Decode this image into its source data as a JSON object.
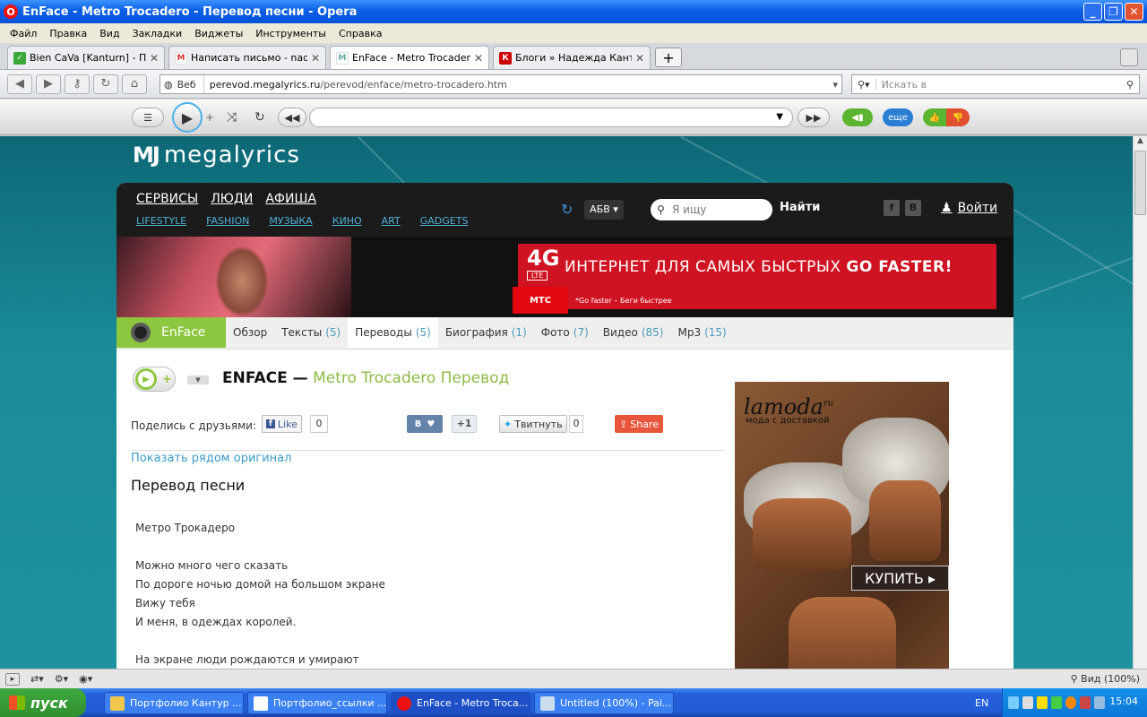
{
  "window": {
    "title": "EnFace - Metro Trocadero - Перевод песни - Opera",
    "minimize": "_",
    "maximize": "❐",
    "close": "✕"
  },
  "menu": [
    "Файл",
    "Правка",
    "Вид",
    "Закладки",
    "Виджеты",
    "Инструменты",
    "Справка"
  ],
  "tabs": [
    {
      "label": "Bien CaVa [Kanturn] - П...",
      "close": "✕",
      "icon_color": "#3aa93a",
      "icon_char": "✓"
    },
    {
      "label": "Написать письмо - nad...",
      "close": "✕",
      "icon_color": "#d33",
      "icon_char": "M"
    },
    {
      "label": "EnFace - Metro Trocader...",
      "close": "✕",
      "icon_color": "#6aa",
      "icon_char": "M"
    },
    {
      "label": "Блоги » Надежда Кант...",
      "close": "✕",
      "icon_color": "#c00",
      "icon_char": "К"
    }
  ],
  "address": {
    "web_label": "Веб",
    "domain": "perevod.megalyrics.ru",
    "path": "/perevod/enface/metro-trocadero.htm",
    "search_placeholder": "Искать в"
  },
  "player": {
    "more_label": "еще"
  },
  "site": {
    "logo": "megalyrics",
    "main_nav": [
      "СЕРВИСЫ",
      "ЛЮДИ",
      "АФИША"
    ],
    "sub_nav": [
      "LIFESTYLE",
      "FASHION",
      "МУЗЫКА",
      "КИНО",
      "ART",
      "GADGETS"
    ],
    "lang_select": "АБВ ▾",
    "search_placeholder": "Я ищу",
    "find_button": "Найти",
    "login": "Войти"
  },
  "banner": {
    "logo": "4G",
    "lte": "LTE",
    "headline": "ИНТЕРНЕТ ДЛЯ САМЫХ БЫСТРЫХ",
    "headline_bold": "GO FASTER!",
    "brand": "МТС",
    "sub": "*Go faster – Беги быстрее"
  },
  "artist": {
    "name": "EnFace",
    "tabs": [
      {
        "label": "Обзор",
        "count": ""
      },
      {
        "label": "Тексты",
        "count": "(5)"
      },
      {
        "label": "Переводы",
        "count": "(5)"
      },
      {
        "label": "Биография",
        "count": "(1)"
      },
      {
        "label": "Фото",
        "count": "(7)"
      },
      {
        "label": "Видео",
        "count": "(85)"
      },
      {
        "label": "Mp3",
        "count": "(15)"
      }
    ]
  },
  "song": {
    "artist": "ENFACE —",
    "title": "Metro Trocadero Перевод"
  },
  "social": {
    "share_label": "Поделись с друзьями:",
    "fb_like": "Like",
    "fb_count": "0",
    "vk_label": "В",
    "vk_count": "+1",
    "tweet": "Твитнуть",
    "tw_count": "0",
    "share": "Share"
  },
  "show_original": "Показать рядом оригинал",
  "translation_title": "Перевод песни",
  "lyrics": [
    "Метро Трокадеро",
    "",
    "Можно много чего сказать",
    "По дороге ночью домой на большом экране",
    "Вижу тебя",
    "И меня, в одеждах королей.",
    "",
    "На экране люди рождаются и умирают"
  ],
  "ad": {
    "brand": "lamoda",
    "brand_sup": "ru",
    "tagline": "мода с доставкой",
    "buy": "КУПИТЬ ▸"
  },
  "status": {
    "zoom": "Вид (100%)"
  },
  "taskbar": {
    "start": "пуск",
    "items": [
      "Портфолио Кантур ...",
      "Портфолио_ссылки ...",
      "EnFace - Metro Troca...",
      "Untitled (100%) - Pai..."
    ],
    "lang": "EN",
    "clock": "15:04"
  },
  "colors": {
    "accent_green": "#8dc63f",
    "link_blue": "#3a9ac7",
    "mts_red": "#d01322"
  }
}
